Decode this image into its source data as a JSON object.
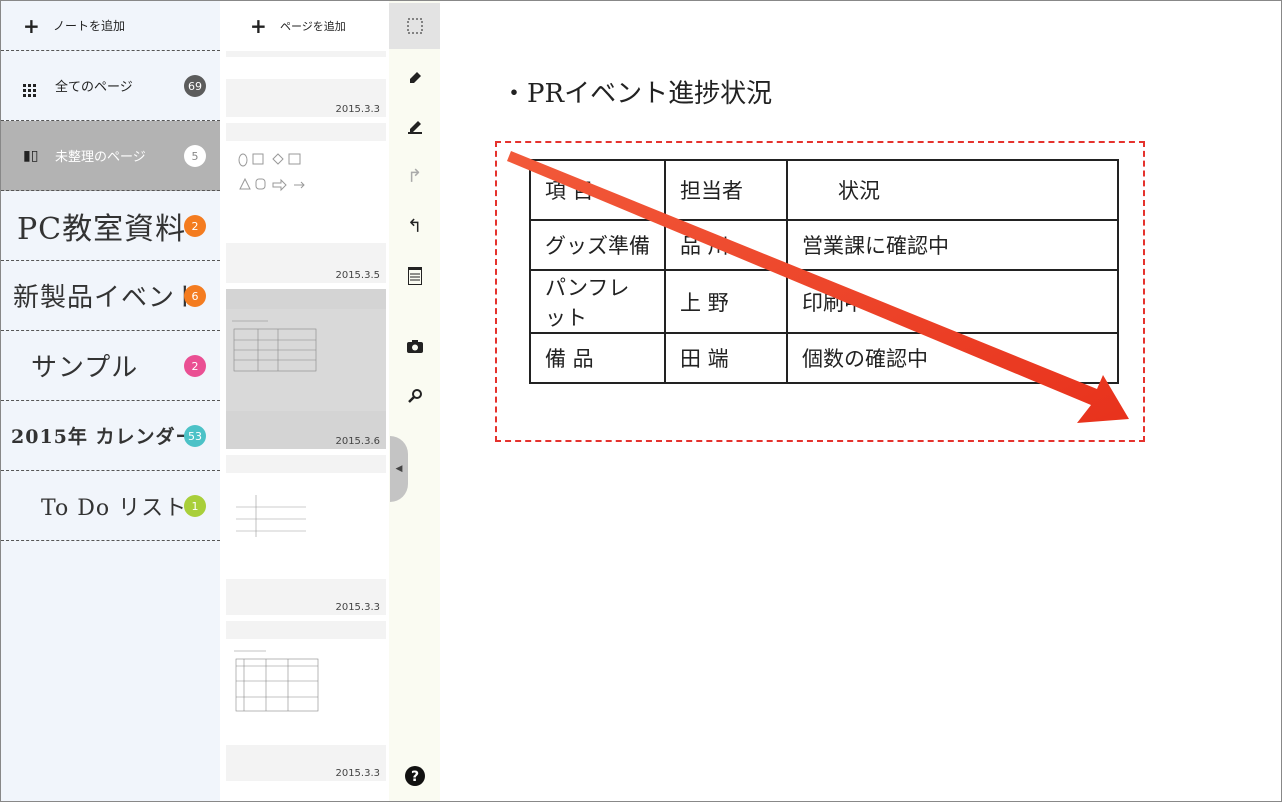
{
  "sidebar": {
    "add_note_label": "ノートを追加",
    "items": [
      {
        "label": "全てのページ",
        "count": "69",
        "badge_color": "#5c5c5c"
      },
      {
        "label": "未整理のページ",
        "count": "5",
        "badge_color": "#ffffff"
      },
      {
        "label": "PC教室資料",
        "count": "2",
        "badge_color": "#f47c20"
      },
      {
        "label": "新製品イベント",
        "count": "6",
        "badge_color": "#f47c20"
      },
      {
        "label": "サンプル",
        "count": "2",
        "badge_color": "#ea4f93"
      },
      {
        "label": "2015年 カレンダー",
        "count": "53",
        "badge_color": "#4cc2c7"
      },
      {
        "label": "To Do リスト",
        "count": "1",
        "badge_color": "#a9cf3a"
      }
    ]
  },
  "pages": {
    "add_page_label": "ページを追加",
    "dates": [
      "2015.3.3",
      "2015.3.5",
      "2015.3.6",
      "2015.3.3",
      "2015.3.3"
    ]
  },
  "canvas": {
    "title": "・PRイベント進捗状況",
    "table": {
      "headers": [
        "項 目",
        "担当者",
        "状況"
      ],
      "rows": [
        [
          "グッズ準備",
          "品 川",
          "営業課に確認中"
        ],
        [
          "パンフレット",
          "上 野",
          "印刷中"
        ],
        [
          "備 品",
          "田 端",
          "個数の確認中"
        ]
      ]
    }
  },
  "colors": {
    "accent": "#f0452a",
    "selection_border": "#e5322d",
    "sidebar_bg": "#f1f5fb",
    "toolbar_bg": "#fafbf2"
  }
}
